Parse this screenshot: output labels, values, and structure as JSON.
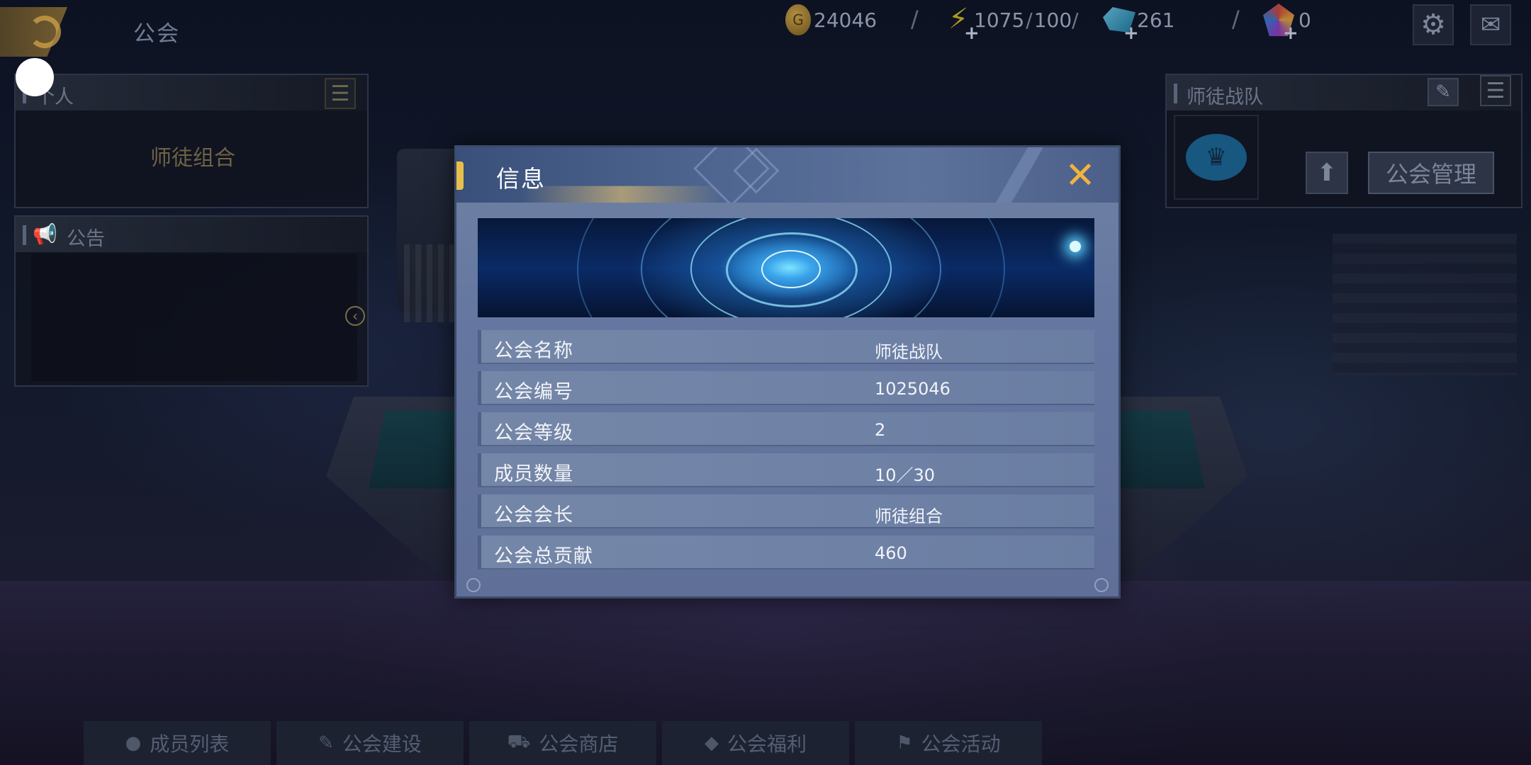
{
  "topbar": {
    "title": "公会",
    "gold": "24046",
    "energy": "1075",
    "energy_max": "100",
    "diamond": "261",
    "gem": "0",
    "separator": "/"
  },
  "left_panel": {
    "header": "个人",
    "content": "师徒组合"
  },
  "notice_panel": {
    "header": "公告"
  },
  "right_panel": {
    "header": "师徒战队",
    "manage_button": "公会管理"
  },
  "bottom_tabs": [
    {
      "label": "成员列表",
      "icon": "person-icon"
    },
    {
      "label": "公会建设",
      "icon": "edit-icon"
    },
    {
      "label": "公会商店",
      "icon": "cart-icon"
    },
    {
      "label": "公会福利",
      "icon": "gift-icon"
    },
    {
      "label": "公会活动",
      "icon": "flag-icon"
    }
  ],
  "dialog": {
    "title": "信息",
    "rows": [
      {
        "label": "公会名称",
        "value": "师徒战队"
      },
      {
        "label": "公会编号",
        "value": "1025046"
      },
      {
        "label": "公会等级",
        "value": "2"
      },
      {
        "label": "成员数量",
        "value": "10／30"
      },
      {
        "label": "公会会长",
        "value": "师徒组合"
      },
      {
        "label": "公会总贡献",
        "value": "460"
      }
    ]
  },
  "colors": {
    "accent_gold": "#f0b43c",
    "dialog_bg": "#6577a0"
  }
}
